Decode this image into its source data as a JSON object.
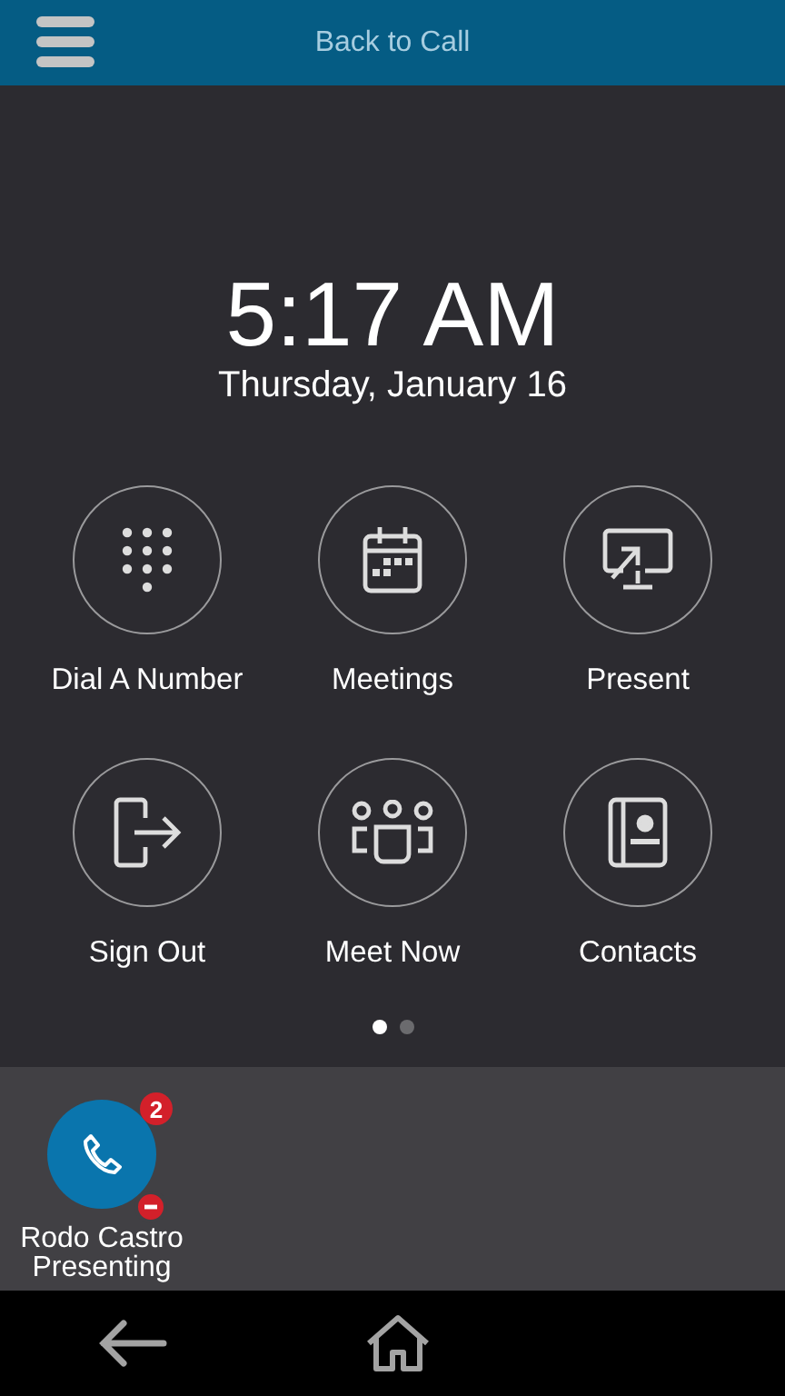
{
  "header": {
    "title": "Back to Call"
  },
  "clock": {
    "time": "5:17 AM",
    "date": "Thursday, January 16"
  },
  "actions": [
    {
      "label": "Dial A Number"
    },
    {
      "label": "Meetings"
    },
    {
      "label": "Present"
    },
    {
      "label": "Sign Out"
    },
    {
      "label": "Meet Now"
    },
    {
      "label": "Contacts"
    }
  ],
  "pages": [
    {
      "selected": true
    },
    {
      "selected": false
    }
  ],
  "call": {
    "name": "Rodo Castro",
    "status": "Presenting",
    "badge": "2"
  }
}
